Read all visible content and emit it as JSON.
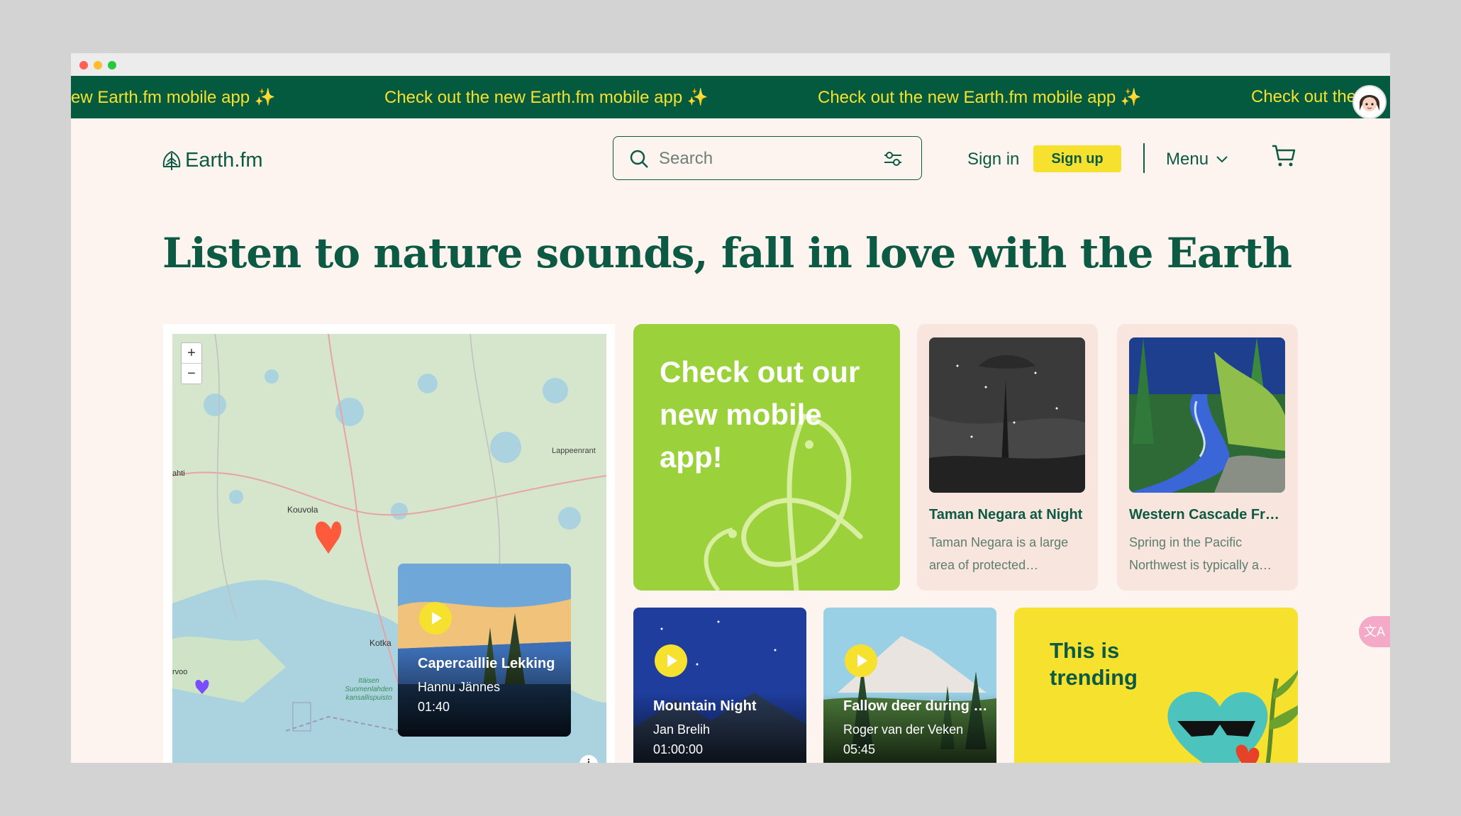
{
  "banner": {
    "items": [
      "ew Earth.fm mobile app ✨",
      "Check out the new Earth.fm mobile app ✨",
      "Check out the new Earth.fm mobile app ✨",
      "Check out the"
    ]
  },
  "header": {
    "logo_text": "Earth.fm",
    "search_placeholder": "Search",
    "signin_label": "Sign in",
    "signup_label": "Sign up",
    "menu_label": "Menu"
  },
  "headline": "Listen to nature sounds, fall in love with the Earth",
  "map": {
    "zoom_in": "+",
    "zoom_out": "−",
    "info": "i",
    "labels": {
      "lappeenranta": "Lappeenrant",
      "kouvola": "Kouvola",
      "kotka": "Kotka",
      "lahti": "ahti",
      "porvoo": "rvoo",
      "park": "Itäisen Suomenlahden kansallispuisto"
    },
    "popup": {
      "title": "Capercaillie Lekking",
      "author": "Hannu Jännes",
      "duration": "01:40"
    }
  },
  "promo": {
    "text": "Check out our new mobile app!"
  },
  "recommended": [
    {
      "title": "Taman Negara at Night",
      "description": "Taman Negara is a large area of protected…"
    },
    {
      "title": "Western Cascade Fr…",
      "description": "Spring in the Pacific Northwest is typically a…"
    }
  ],
  "tiles": [
    {
      "title": "Mountain Night",
      "author": "Jan Brelih",
      "duration": "01:00:00"
    },
    {
      "title": "Fallow deer during …",
      "author": "Roger van der Veken",
      "duration": "05:45"
    }
  ],
  "trending": {
    "line1": "This is",
    "line2": "trending"
  },
  "translate_icon_text": "文A",
  "colors": {
    "brand_green": "#0c5a44",
    "banner_green": "#035a3f",
    "accent_yellow": "#f6e12e",
    "promo_green": "#9bd23c",
    "page_bg": "#fdf3ef"
  }
}
